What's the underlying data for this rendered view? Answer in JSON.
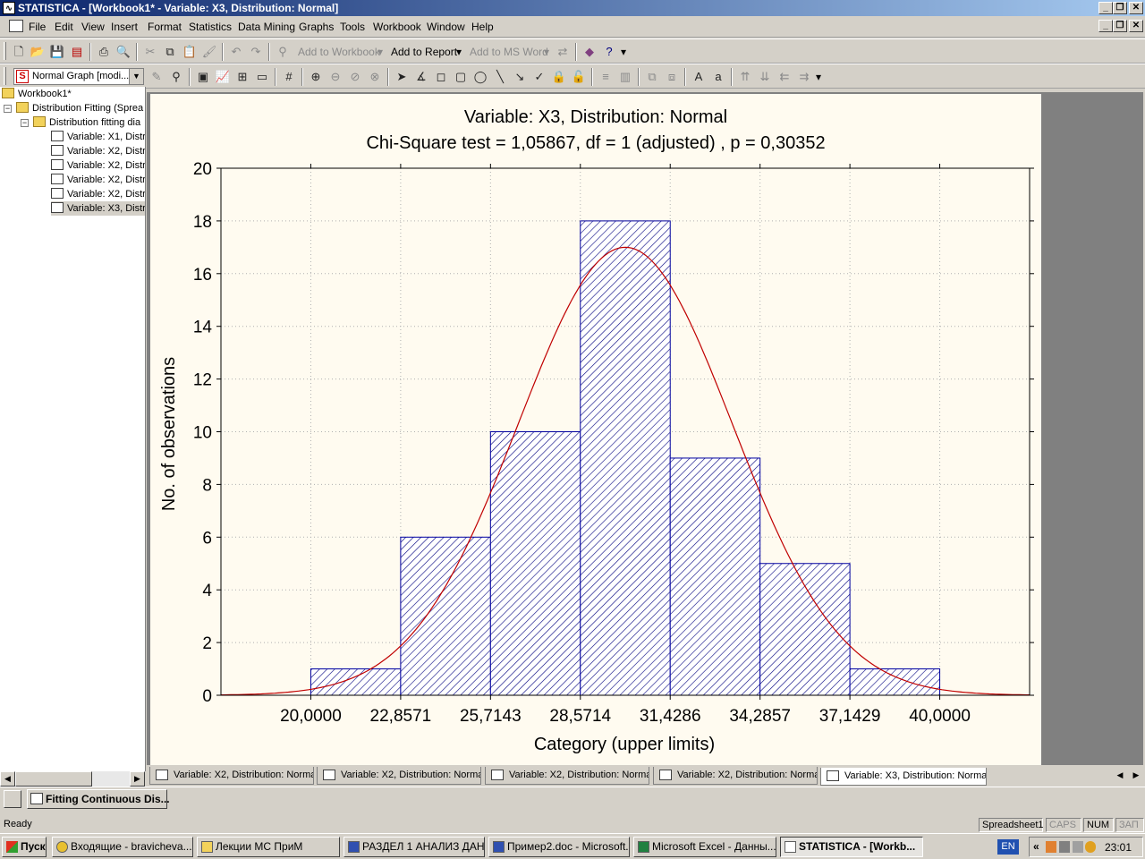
{
  "app": {
    "title": "STATISTICA - [Workbook1* - Variable: X3, Distribution: Normal]",
    "app_icon": "statistica-icon"
  },
  "menu": [
    "File",
    "Edit",
    "View",
    "Insert",
    "Format",
    "Statistics",
    "Data Mining",
    "Graphs",
    "Tools",
    "Workbook",
    "Window",
    "Help"
  ],
  "toolbar1": {
    "add_to_workbook": "Add to Workbook",
    "add_to_report": "Add to Report",
    "add_to_msword": "Add to MS Word"
  },
  "toolbar2": {
    "graph_style_select": "Normal Graph [modi..."
  },
  "tree": {
    "root": "Workbook1*",
    "level1": "Distribution Fitting (Sprea",
    "level2": "Distribution fitting dia",
    "items": [
      "Variable: X1, Distri",
      "Variable: X2, Distri",
      "Variable: X2, Distri",
      "Variable: X2, Distri",
      "Variable: X2, Distri",
      "Variable: X3, Distri"
    ]
  },
  "tabs": [
    "Variable: X2, Distribution: Normal",
    "Variable: X2, Distribution: Normal",
    "Variable: X2, Distribution: Normal",
    "Variable: X2, Distribution: Normal",
    "Variable: X3, Distribution: Normal"
  ],
  "analysis_bar": {
    "button": "Fitting Continuous Dis..."
  },
  "status": {
    "left": "Ready",
    "pane_spreadsheet": "Spreadsheet1",
    "pane_caps": "CAPS",
    "pane_num": "NUM",
    "pane_zap": "ЗАП"
  },
  "taskbar": {
    "start": "Пуск",
    "items": [
      "Входящие - bravicheva...",
      "Лекции МС ПриМ",
      "РАЗДЕЛ 1 АНАЛИЗ ДАН...",
      "Пример2.doc - Microsoft...",
      "Microsoft Excel - Данны...",
      "STATISTICA - [Workb..."
    ],
    "lang": "EN",
    "clock": "23:01"
  },
  "colors": {
    "bar_stroke": "#0000a0",
    "curve": "#c00000",
    "paper": "#fffbf0",
    "titlebar": "#0a246a"
  },
  "chart_data": {
    "type": "bar",
    "title": "Variable: X3, Distribution: Normal",
    "subtitle": "Chi-Square test = 1,05867, df = 1 (adjusted) , p = 0,30352",
    "xlabel": "Category (upper limits)",
    "ylabel": "No. of observations",
    "ylim": [
      0,
      20
    ],
    "yticks": [
      0,
      2,
      4,
      6,
      8,
      10,
      12,
      14,
      16,
      18,
      20
    ],
    "xlim": [
      17.1429,
      42.8571
    ],
    "xtick_values": [
      20.0,
      22.8571,
      25.7143,
      28.5714,
      31.4286,
      34.2857,
      37.1429,
      40.0
    ],
    "xtick_labels": [
      "20,0000",
      "22,8571",
      "25,7143",
      "28,5714",
      "31,4286",
      "34,2857",
      "37,1429",
      "40,0000"
    ],
    "bins": [
      {
        "from": 20.0,
        "to": 22.8571,
        "count": 1
      },
      {
        "from": 22.8571,
        "to": 25.7143,
        "count": 6
      },
      {
        "from": 25.7143,
        "to": 28.5714,
        "count": 10
      },
      {
        "from": 28.5714,
        "to": 31.4286,
        "count": 18
      },
      {
        "from": 31.4286,
        "to": 34.2857,
        "count": 9
      },
      {
        "from": 34.2857,
        "to": 37.1429,
        "count": 5
      },
      {
        "from": 37.1429,
        "to": 40.0,
        "count": 1
      }
    ],
    "fitted_curve": {
      "distribution": "Normal",
      "peak_x": 30.0,
      "peak_y": 17.0,
      "sd": 3.4
    },
    "grid": true
  }
}
